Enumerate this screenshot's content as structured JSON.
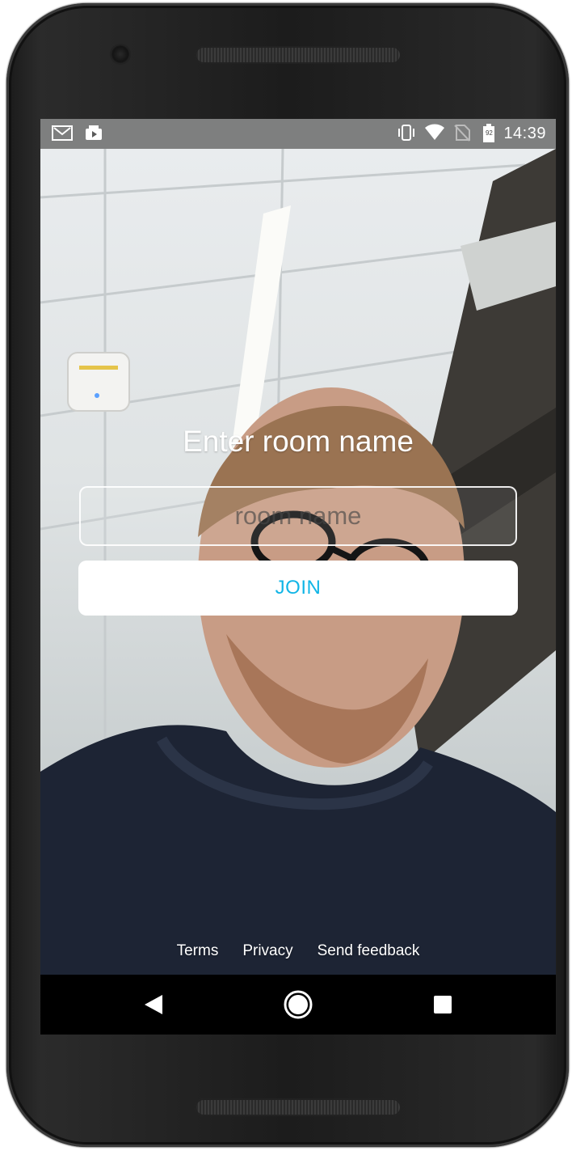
{
  "status_bar": {
    "time": "14:39",
    "battery_level": "92",
    "left_icons": [
      "gmail-icon",
      "media-icon"
    ],
    "right_icons": [
      "vibrate-icon",
      "wifi-icon",
      "no-sim-icon",
      "battery-icon"
    ]
  },
  "join_screen": {
    "title": "Enter room name",
    "room_input": {
      "value": "",
      "placeholder": "room name"
    },
    "join_label": "JOIN"
  },
  "footer": {
    "terms_label": "Terms",
    "privacy_label": "Privacy",
    "feedback_label": "Send feedback"
  },
  "nav_bar": {
    "icons": [
      "back-icon",
      "home-icon",
      "recent-apps-icon"
    ]
  },
  "colors": {
    "accent": "#11b5e6",
    "status_bar": "#5a5a5a",
    "nav_bar": "#000000"
  }
}
